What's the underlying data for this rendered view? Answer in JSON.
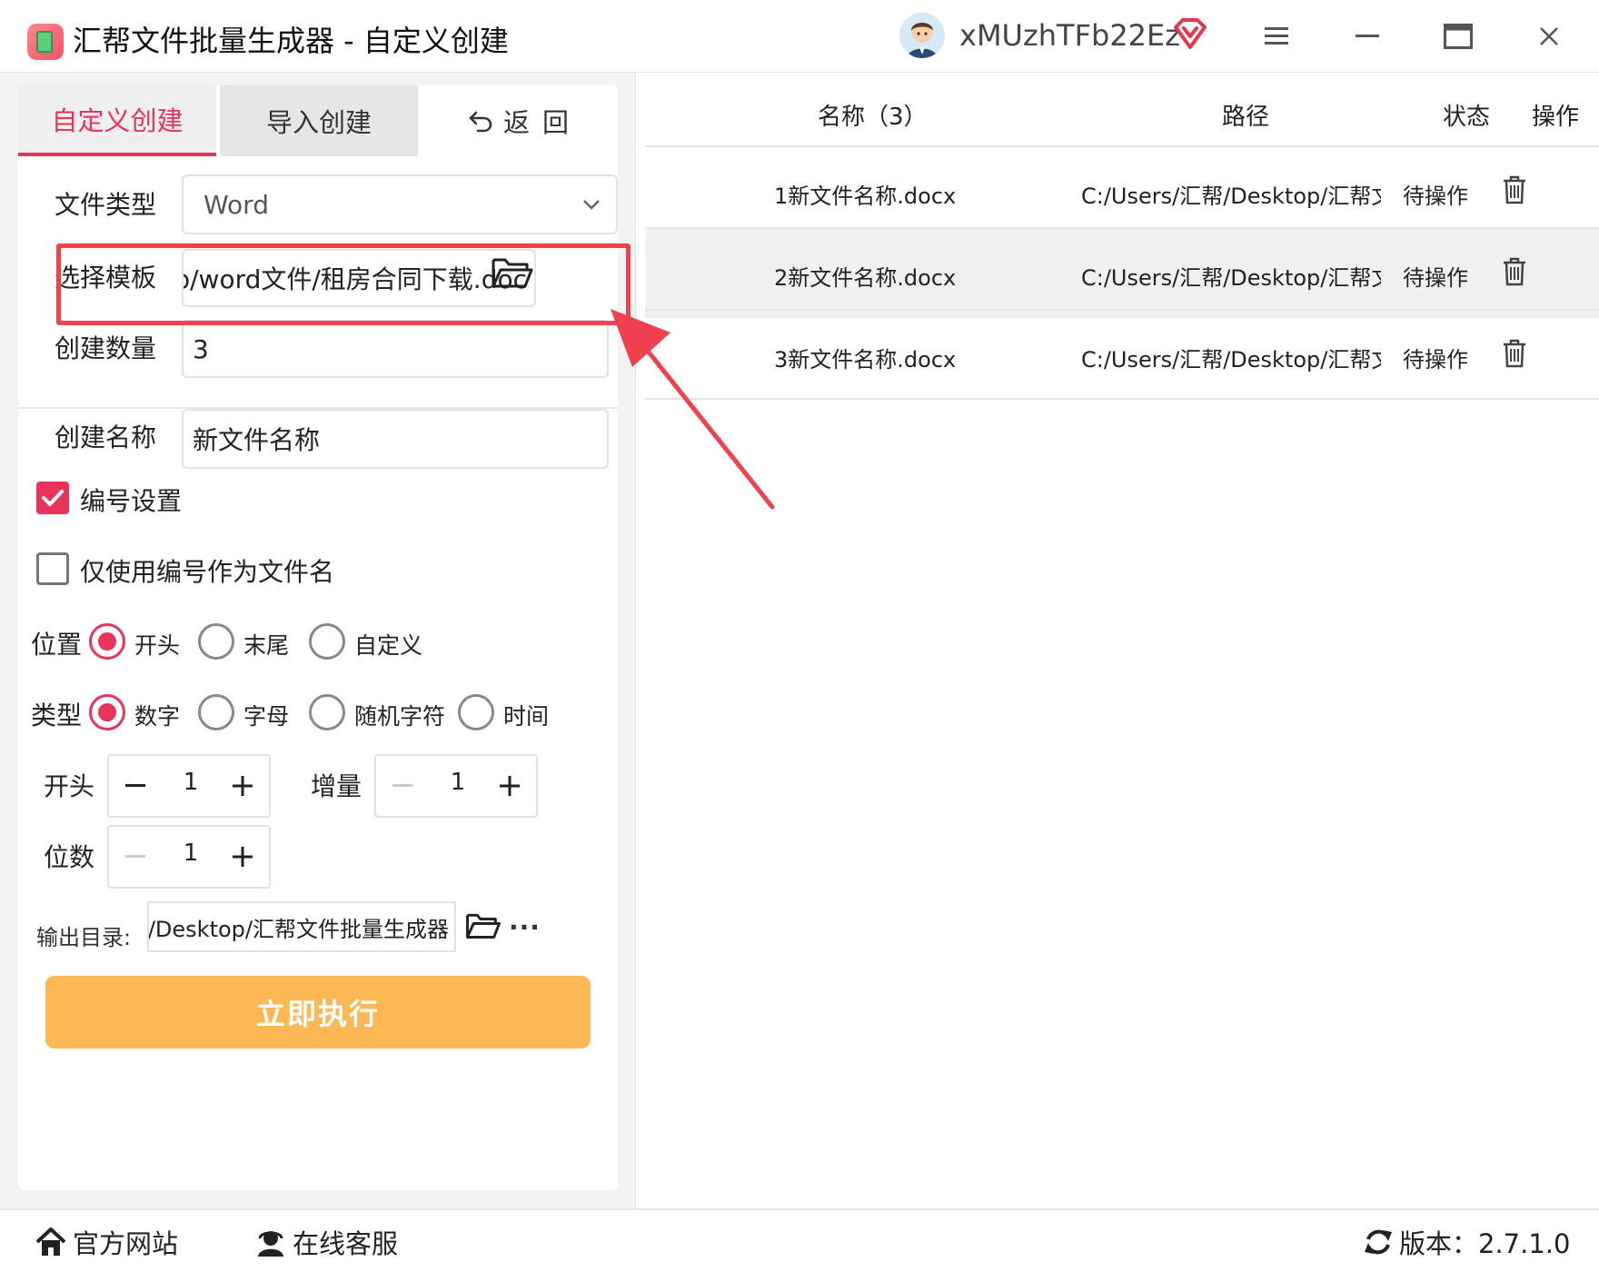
{
  "window": {
    "title": "汇帮文件批量生成器 - 自定义创建",
    "username": "xMUzhTFb22Ez",
    "icons": [
      "app-logo-icon",
      "avatar",
      "vip-icon",
      "menu-icon",
      "minimize-icon",
      "maximize-icon",
      "close-icon"
    ]
  },
  "tabs": {
    "custom": "自定义创建",
    "import": "导入创建",
    "back": "返回"
  },
  "form": {
    "file_type_label": "文件类型",
    "file_type_value": "Word",
    "template_label": "选择模板",
    "template_value": "C:/Users/汇帮/Desktop/word文件/租房合同下载.doc",
    "count_label": "创建数量",
    "count_value": "3",
    "name_label": "创建名称",
    "name_value": "新文件名称",
    "numbering_label": "编号设置",
    "numbering_checked": true,
    "only_number_label": "仅使用编号作为文件名",
    "only_number_checked": false,
    "position_label": "位置",
    "position_options": [
      "开头",
      "末尾",
      "自定义"
    ],
    "position_selected": "开头",
    "type_label": "类型",
    "type_options": [
      "数字",
      "字母",
      "随机字符",
      "时间"
    ],
    "type_selected": "数字",
    "start_label": "开头",
    "start_value": "1",
    "increment_label": "增量",
    "increment_value": "1",
    "digits_label": "位数",
    "digits_value": "1",
    "output_label": "输出目录:",
    "output_value": "C:/Users/汇帮/Desktop/汇帮文件批量生成器",
    "more_label": "···",
    "run_button": "立即执行"
  },
  "table": {
    "headers": {
      "name": "名称（3）",
      "path": "路径",
      "status": "状态",
      "action": "操作"
    },
    "rows": [
      {
        "name": "1新文件名称.docx",
        "path": "C:/Users/汇帮/Desktop/汇帮文件",
        "status": "待操作"
      },
      {
        "name": "2新文件名称.docx",
        "path": "C:/Users/汇帮/Desktop/汇帮文件",
        "status": "待操作"
      },
      {
        "name": "3新文件名称.docx",
        "path": "C:/Users/汇帮/Desktop/汇帮文件",
        "status": "待操作"
      }
    ]
  },
  "footer": {
    "website": "官方网站",
    "service": "在线客服",
    "version": "版本：2.7.1.0"
  },
  "colors": {
    "accent": "#e8345b",
    "run_button": "#fdb855",
    "annotation_red": "#f0424e"
  }
}
